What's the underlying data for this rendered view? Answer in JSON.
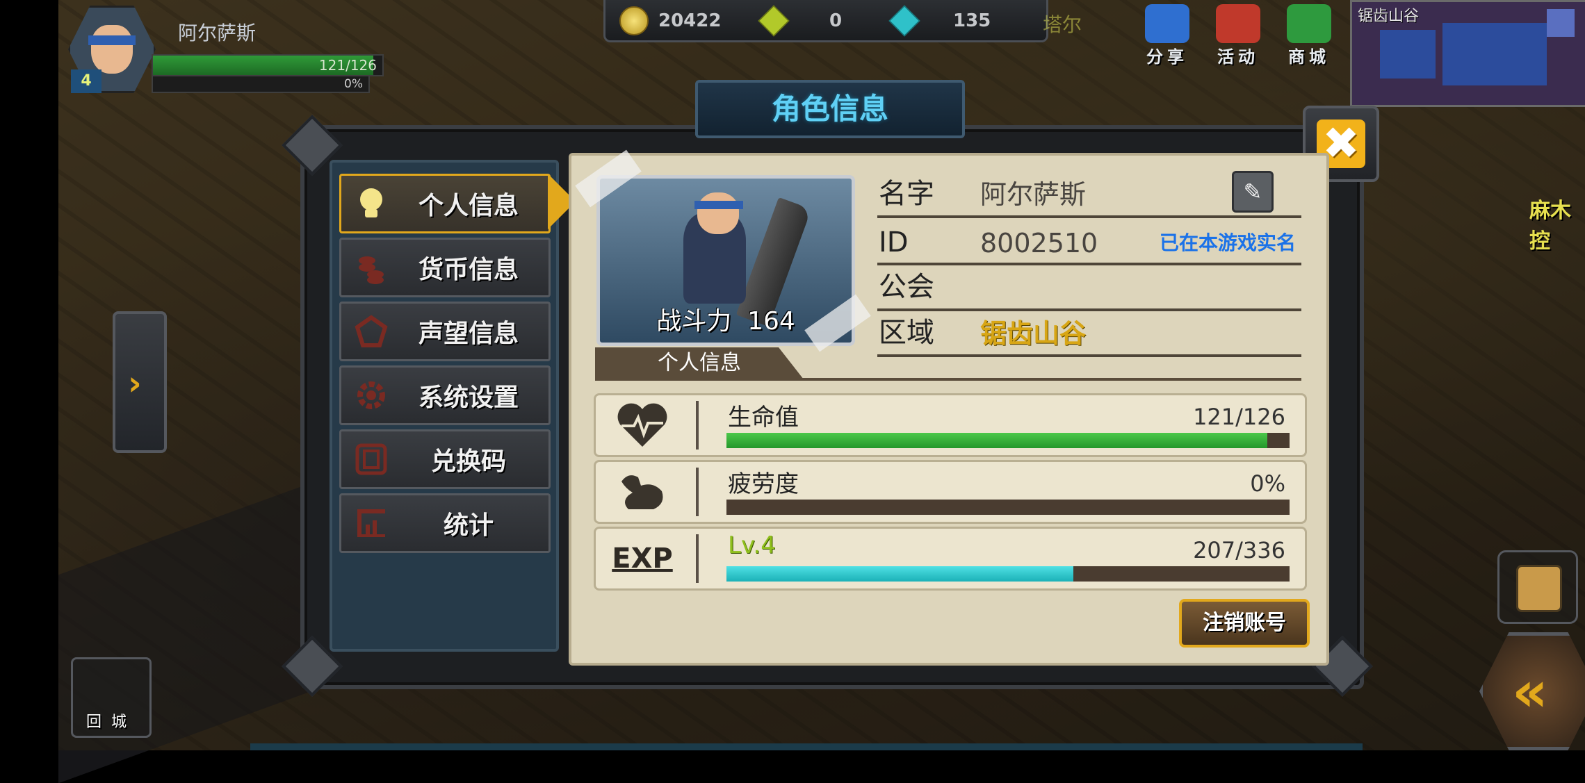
{
  "player_hud": {
    "name": "阿尔萨斯",
    "level": "4",
    "hp_text": "121/126",
    "hp_fraction": 0.96,
    "fatigue_text": "0%"
  },
  "currency": [
    {
      "icon": "gold-coin-icon",
      "value": "20422"
    },
    {
      "icon": "green-gem-icon",
      "value": "0"
    },
    {
      "icon": "blue-diamond-icon",
      "value": "135"
    }
  ],
  "top_buttons": [
    {
      "icon": "share-icon",
      "label": "分享",
      "color": "#2f6fd0"
    },
    {
      "icon": "event-icon",
      "label": "活动",
      "color": "#c0392b"
    },
    {
      "icon": "shop-cart-icon",
      "label": "商城",
      "color": "#2e9a3e"
    }
  ],
  "faded_label": "塔尔",
  "minimap": {
    "title": "锯齿山谷"
  },
  "dialog": {
    "title": "角色信息",
    "close_symbol": "✖"
  },
  "menu": [
    {
      "label": "个人信息",
      "icon": "lightbulb-icon",
      "active": true
    },
    {
      "label": "货币信息",
      "icon": "coins-stack-icon",
      "active": false
    },
    {
      "label": "声望信息",
      "icon": "reputation-badge-icon",
      "active": false
    },
    {
      "label": "系统设置",
      "icon": "gear-icon",
      "active": false
    },
    {
      "label": "兑换码",
      "icon": "redeem-code-icon",
      "active": false
    },
    {
      "label": "统计",
      "icon": "statistics-chart-icon",
      "active": false
    }
  ],
  "profile": {
    "combat_power_label": "战斗力",
    "combat_power": "164",
    "section_tab": "个人信息",
    "name_key": "名字",
    "name_value": "阿尔萨斯",
    "id_key": "ID",
    "id_value": "8002510",
    "realname_link": "已在本游戏实名",
    "guild_key": "公会",
    "guild_value": "",
    "region_key": "区域",
    "region_value": "锯齿山谷",
    "edit_symbol": "✎"
  },
  "stats": {
    "hp": {
      "label": "生命值",
      "value": "121/126",
      "fraction": 0.96,
      "icon": "heart-pulse-icon"
    },
    "fatigue": {
      "label": "疲劳度",
      "value": "0%",
      "fraction": 0.0,
      "icon": "flexed-arm-icon"
    },
    "exp": {
      "icon_text": "EXP",
      "label": "Lv.4",
      "value": "207/336",
      "fraction": 0.616,
      "icon": "exp-icon"
    }
  },
  "logout_button": "注销账号",
  "side": {
    "expand_symbol": "›",
    "home_label": "回城",
    "attack_symbol": "«",
    "npc_label": "麻木控"
  },
  "footer_text": "锯齿山谷"
}
